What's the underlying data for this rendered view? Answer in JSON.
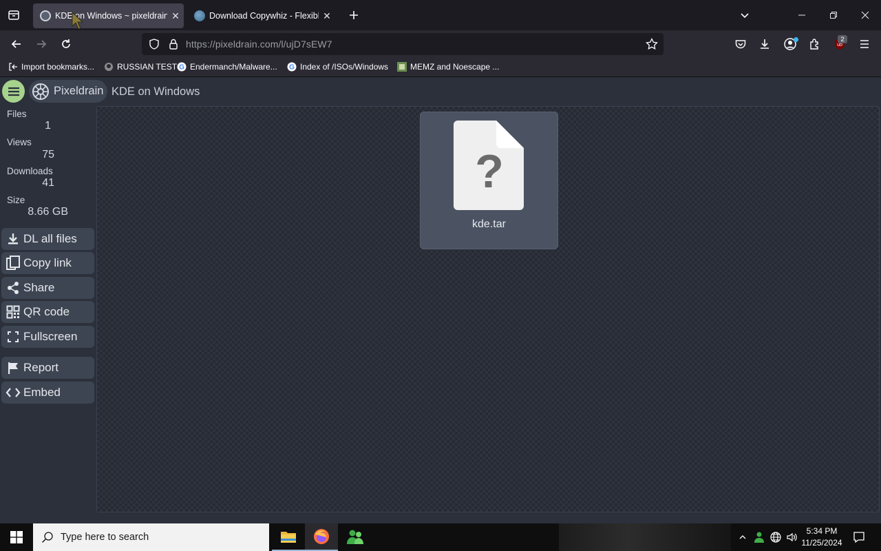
{
  "browser": {
    "tabs": [
      {
        "title": "KDE on Windows ~ pixeldrain",
        "active": true
      },
      {
        "title": "Download Copywhiz - Flexible",
        "active": false
      }
    ],
    "url": "https://pixeldrain.com/l/ujD7sEW7",
    "extension_badge": "2",
    "bookmarks": [
      {
        "label": "Import bookmarks..."
      },
      {
        "label": "RUSSIAN TEST"
      },
      {
        "label": "Endermanch/Malware..."
      },
      {
        "label": "Index of /ISOs/Windows"
      },
      {
        "label": "MEMZ and Noescape ..."
      }
    ]
  },
  "page": {
    "brand": "Pixeldrain",
    "title": "KDE on Windows",
    "stats": [
      {
        "label": "Files",
        "value": "1"
      },
      {
        "label": "Views",
        "value": "75"
      },
      {
        "label": "Downloads",
        "value": "41"
      },
      {
        "label": "Size",
        "value": "8.66 GB"
      }
    ],
    "actions": [
      {
        "label": "DL all files",
        "icon": "download-icon"
      },
      {
        "label": "Copy link",
        "icon": "copy-icon"
      },
      {
        "label": "Share",
        "icon": "share-icon"
      },
      {
        "label": "QR code",
        "icon": "qr-code-icon"
      },
      {
        "label": "Fullscreen",
        "icon": "fullscreen-icon"
      },
      {
        "label": "Report",
        "icon": "flag-icon"
      },
      {
        "label": "Embed",
        "icon": "code-icon"
      }
    ],
    "file": {
      "name": "kde.tar",
      "icon_glyph": "?"
    }
  },
  "taskbar": {
    "search_placeholder": "Type here to search",
    "time": "5:34 PM",
    "date": "11/25/2024"
  },
  "colors": {
    "accent_green": "#a6d38c",
    "page_bg": "#2b303b",
    "button_bg": "#3e4552"
  }
}
